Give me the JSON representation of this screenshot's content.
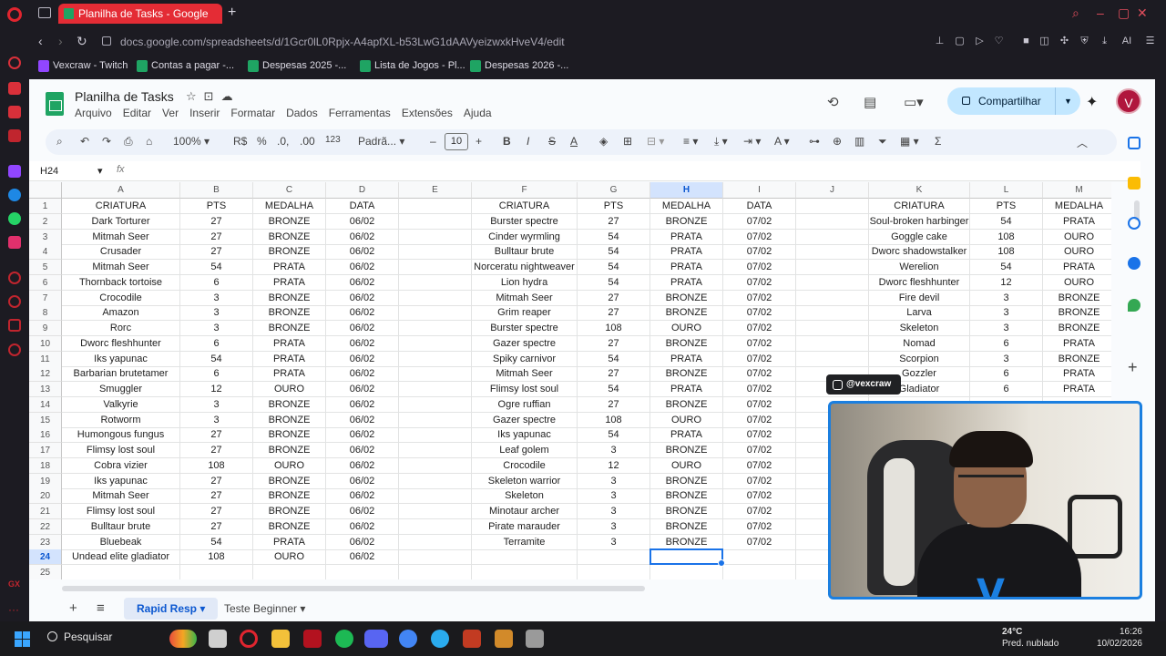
{
  "browser": {
    "tab_title": "Planilha de Tasks - Google",
    "url": "docs.google.com/spreadsheets/d/1Gcr0lL0Rpjx-A4apfXL-b53LwG1dAAVyeizwxkHveV4/edit",
    "bookmarks": [
      "Vexcraw - Twitch",
      "Contas a pagar -...",
      "Despesas 2025 -...",
      "Lista de Jogos - Pl...",
      "Despesas 2026 -..."
    ],
    "ai_label": "AI"
  },
  "sheets": {
    "title": "Planilha de Tasks",
    "menu": [
      "Arquivo",
      "Editar",
      "Ver",
      "Inserir",
      "Formatar",
      "Dados",
      "Ferramentas",
      "Extensões",
      "Ajuda"
    ],
    "share_label": "Compartilhar",
    "avatar_letter": "V",
    "toolbar": {
      "zoom": "100%",
      "currency": "R$",
      "percent": "%",
      "dec_minus": ".0,",
      "dec_plus": ".00",
      "num_format": "123",
      "font": "Padrã...",
      "font_size": "10",
      "bold": "B",
      "italic": "I",
      "strike": "S",
      "text_color": "A",
      "sigma": "Σ"
    },
    "name_box": "H24",
    "fx": "fx",
    "columns": [
      {
        "id": "A",
        "w": 130
      },
      {
        "id": "B",
        "w": 80
      },
      {
        "id": "C",
        "w": 80
      },
      {
        "id": "D",
        "w": 80
      },
      {
        "id": "E",
        "w": 80
      },
      {
        "id": "F",
        "w": 116
      },
      {
        "id": "G",
        "w": 80
      },
      {
        "id": "H",
        "w": 80
      },
      {
        "id": "I",
        "w": 80
      },
      {
        "id": "J",
        "w": 80
      },
      {
        "id": "K",
        "w": 111
      },
      {
        "id": "L",
        "w": 80
      },
      {
        "id": "M",
        "w": 80
      }
    ],
    "selected_column": "H",
    "selected_row": 24,
    "rows": [
      [
        "CRIATURA",
        "PTS",
        "MEDALHA",
        "DATA",
        "",
        "CRIATURA",
        "PTS",
        "MEDALHA",
        "DATA",
        "",
        "CRIATURA",
        "PTS",
        "MEDALHA"
      ],
      [
        "Dark Torturer",
        "27",
        "BRONZE",
        "06/02",
        "",
        "Burster spectre",
        "27",
        "BRONZE",
        "07/02",
        "",
        "Soul-broken harbinger",
        "54",
        "PRATA"
      ],
      [
        "Mitmah Seer",
        "27",
        "BRONZE",
        "06/02",
        "",
        "Cinder wyrmling",
        "54",
        "PRATA",
        "07/02",
        "",
        "Goggle cake",
        "108",
        "OURO"
      ],
      [
        "Crusader",
        "27",
        "BRONZE",
        "06/02",
        "",
        "Bulltaur brute",
        "54",
        "PRATA",
        "07/02",
        "",
        "Dworc shadowstalker",
        "108",
        "OURO"
      ],
      [
        "Mitmah Seer",
        "54",
        "PRATA",
        "06/02",
        "",
        "Norceratu nightweaver",
        "54",
        "PRATA",
        "07/02",
        "",
        "Werelion",
        "54",
        "PRATA"
      ],
      [
        "Thornback tortoise",
        "6",
        "PRATA",
        "06/02",
        "",
        "Lion hydra",
        "54",
        "PRATA",
        "07/02",
        "",
        "Dworc fleshhunter",
        "12",
        "OURO"
      ],
      [
        "Crocodile",
        "3",
        "BRONZE",
        "06/02",
        "",
        "Mitmah Seer",
        "27",
        "BRONZE",
        "07/02",
        "",
        "Fire devil",
        "3",
        "BRONZE"
      ],
      [
        "Amazon",
        "3",
        "BRONZE",
        "06/02",
        "",
        "Grim reaper",
        "27",
        "BRONZE",
        "07/02",
        "",
        "Larva",
        "3",
        "BRONZE"
      ],
      [
        "Rorc",
        "3",
        "BRONZE",
        "06/02",
        "",
        "Burster spectre",
        "108",
        "OURO",
        "07/02",
        "",
        "Skeleton",
        "3",
        "BRONZE"
      ],
      [
        "Dworc fleshhunter",
        "6",
        "PRATA",
        "06/02",
        "",
        "Gazer spectre",
        "27",
        "BRONZE",
        "07/02",
        "",
        "Nomad",
        "6",
        "PRATA"
      ],
      [
        "Iks yapunac",
        "54",
        "PRATA",
        "06/02",
        "",
        "Spiky carnivor",
        "54",
        "PRATA",
        "07/02",
        "",
        "Scorpion",
        "3",
        "BRONZE"
      ],
      [
        "Barbarian brutetamer",
        "6",
        "PRATA",
        "06/02",
        "",
        "Mitmah Seer",
        "27",
        "BRONZE",
        "07/02",
        "",
        "Gozzler",
        "6",
        "PRATA"
      ],
      [
        "Smuggler",
        "12",
        "OURO",
        "06/02",
        "",
        "Flimsy lost soul",
        "54",
        "PRATA",
        "07/02",
        "",
        "Gladiator",
        "6",
        "PRATA"
      ],
      [
        "Valkyrie",
        "3",
        "BRONZE",
        "06/02",
        "",
        "Ogre ruffian",
        "27",
        "BRONZE",
        "07/02",
        "",
        "",
        "",
        ""
      ],
      [
        "Rotworm",
        "3",
        "BRONZE",
        "06/02",
        "",
        "Gazer spectre",
        "108",
        "OURO",
        "07/02",
        "",
        "",
        "",
        ""
      ],
      [
        "Humongous fungus",
        "27",
        "BRONZE",
        "06/02",
        "",
        "Iks yapunac",
        "54",
        "PRATA",
        "07/02",
        "",
        "",
        "",
        ""
      ],
      [
        "Flimsy lost soul",
        "27",
        "BRONZE",
        "06/02",
        "",
        "Leaf golem",
        "3",
        "BRONZE",
        "07/02",
        "",
        "",
        "",
        ""
      ],
      [
        "Cobra vizier",
        "108",
        "OURO",
        "06/02",
        "",
        "Crocodile",
        "12",
        "OURO",
        "07/02",
        "",
        "",
        "",
        ""
      ],
      [
        "Iks yapunac",
        "27",
        "BRONZE",
        "06/02",
        "",
        "Skeleton warrior",
        "3",
        "BRONZE",
        "07/02",
        "",
        "",
        "",
        ""
      ],
      [
        "Mitmah Seer",
        "27",
        "BRONZE",
        "06/02",
        "",
        "Skeleton",
        "3",
        "BRONZE",
        "07/02",
        "",
        "",
        "",
        ""
      ],
      [
        "Flimsy lost soul",
        "27",
        "BRONZE",
        "06/02",
        "",
        "Minotaur archer",
        "3",
        "BRONZE",
        "07/02",
        "",
        "",
        "",
        ""
      ],
      [
        "Bulltaur brute",
        "27",
        "BRONZE",
        "06/02",
        "",
        "Pirate marauder",
        "3",
        "BRONZE",
        "07/02",
        "",
        "",
        "",
        ""
      ],
      [
        "Bluebeak",
        "54",
        "PRATA",
        "06/02",
        "",
        "Terramite",
        "3",
        "BRONZE",
        "07/02",
        "",
        "",
        "",
        ""
      ],
      [
        "Undead elite gladiator",
        "108",
        "OURO",
        "06/02",
        "",
        "",
        "",
        "",
        "",
        "",
        "",
        "",
        ""
      ],
      [
        "",
        "",
        "",
        "",
        "",
        "",
        "",
        "",
        "",
        "",
        "",
        "",
        ""
      ]
    ],
    "sheet_tabs": [
      "Rapid Resp",
      "Teste Beginner"
    ],
    "active_sheet": "Rapid Resp"
  },
  "stream": {
    "handle": "@vexcraw"
  },
  "taskbar": {
    "search_label": "Pesquisar",
    "temperature": "24°C",
    "weather_desc": "Pred. nublado",
    "time": "16:26",
    "date": "10/02/2026"
  }
}
